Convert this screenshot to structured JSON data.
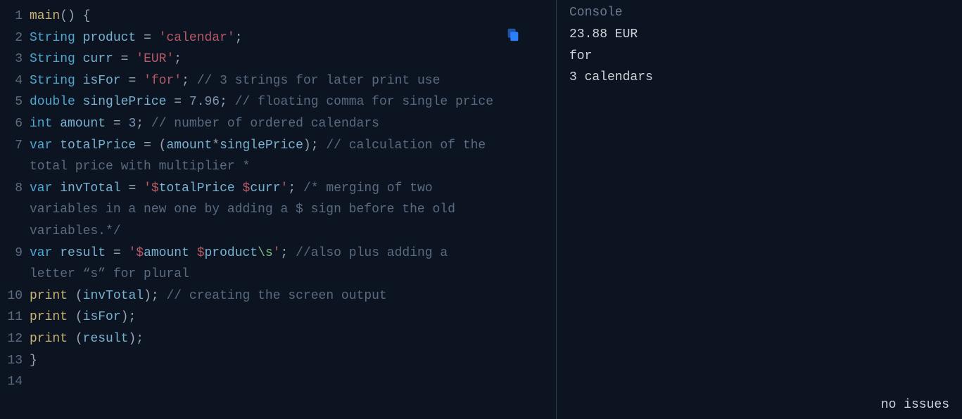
{
  "editor": {
    "lines": [
      {
        "num": "1",
        "tokens": [
          [
            "fn",
            "main"
          ],
          [
            "punc",
            "() {"
          ]
        ]
      },
      {
        "num": "2",
        "tokens": [
          [
            "kw",
            "String"
          ],
          [
            "pl",
            " "
          ],
          [
            "id",
            "product"
          ],
          [
            "pl",
            " "
          ],
          [
            "punc",
            "="
          ],
          [
            "pl",
            " "
          ],
          [
            "str",
            "'calendar'"
          ],
          [
            "punc",
            ";"
          ]
        ]
      },
      {
        "num": "3",
        "tokens": [
          [
            "kw",
            "String"
          ],
          [
            "pl",
            " "
          ],
          [
            "id",
            "curr"
          ],
          [
            "pl",
            " "
          ],
          [
            "punc",
            "="
          ],
          [
            "pl",
            " "
          ],
          [
            "str",
            "'EUR'"
          ],
          [
            "punc",
            ";"
          ]
        ]
      },
      {
        "num": "4",
        "tokens": [
          [
            "kw",
            "String"
          ],
          [
            "pl",
            " "
          ],
          [
            "id",
            "isFor"
          ],
          [
            "pl",
            " "
          ],
          [
            "punc",
            "="
          ],
          [
            "pl",
            " "
          ],
          [
            "str",
            "'for'"
          ],
          [
            "punc",
            ";"
          ],
          [
            "pl",
            " "
          ],
          [
            "cmt",
            "// 3 strings for later print use"
          ]
        ]
      },
      {
        "num": "5",
        "tokens": [
          [
            "kw",
            "double"
          ],
          [
            "pl",
            " "
          ],
          [
            "id",
            "singlePrice"
          ],
          [
            "pl",
            " "
          ],
          [
            "punc",
            "="
          ],
          [
            "pl",
            " "
          ],
          [
            "num",
            "7.96"
          ],
          [
            "punc",
            ";"
          ],
          [
            "pl",
            " "
          ],
          [
            "cmt",
            "// floating comma for single price"
          ]
        ]
      },
      {
        "num": "6",
        "tokens": [
          [
            "kw",
            "int"
          ],
          [
            "pl",
            " "
          ],
          [
            "id",
            "amount"
          ],
          [
            "pl",
            " "
          ],
          [
            "punc",
            "="
          ],
          [
            "pl",
            " "
          ],
          [
            "num",
            "3"
          ],
          [
            "punc",
            ";"
          ],
          [
            "pl",
            " "
          ],
          [
            "cmt",
            "// number of ordered calendars"
          ]
        ]
      },
      {
        "num": "7",
        "tokens": [
          [
            "kw",
            "var"
          ],
          [
            "pl",
            " "
          ],
          [
            "id",
            "totalPrice"
          ],
          [
            "pl",
            " "
          ],
          [
            "punc",
            "= ("
          ],
          [
            "id",
            "amount"
          ],
          [
            "punc",
            "*"
          ],
          [
            "id",
            "singlePrice"
          ],
          [
            "punc",
            ");"
          ],
          [
            "pl",
            " "
          ],
          [
            "cmt",
            "// calculation of the total price with multiplier *"
          ]
        ]
      },
      {
        "num": "8",
        "tokens": [
          [
            "kw",
            "var"
          ],
          [
            "pl",
            " "
          ],
          [
            "id",
            "invTotal"
          ],
          [
            "pl",
            " "
          ],
          [
            "punc",
            "="
          ],
          [
            "pl",
            " "
          ],
          [
            "str",
            "'$"
          ],
          [
            "id",
            "totalPrice"
          ],
          [
            "str",
            " $"
          ],
          [
            "id",
            "curr"
          ],
          [
            "str",
            "'"
          ],
          [
            "punc",
            ";"
          ],
          [
            "pl",
            " "
          ],
          [
            "cmt",
            "/* merging of two variables in a new one by adding a $ sign before the old variables.*/"
          ]
        ]
      },
      {
        "num": "9",
        "tokens": [
          [
            "kw",
            "var"
          ],
          [
            "pl",
            " "
          ],
          [
            "id",
            "result"
          ],
          [
            "pl",
            " "
          ],
          [
            "punc",
            "="
          ],
          [
            "pl",
            " "
          ],
          [
            "str",
            "'$"
          ],
          [
            "id",
            "amount"
          ],
          [
            "str",
            " $"
          ],
          [
            "id",
            "product"
          ],
          [
            "esc",
            "\\s"
          ],
          [
            "str",
            "'"
          ],
          [
            "punc",
            ";"
          ],
          [
            "pl",
            " "
          ],
          [
            "cmt",
            "//also plus adding a letter “s” for plural"
          ]
        ]
      },
      {
        "num": "10",
        "tokens": [
          [
            "fn",
            "print"
          ],
          [
            "pl",
            " "
          ],
          [
            "punc",
            "("
          ],
          [
            "id",
            "invTotal"
          ],
          [
            "punc",
            ");"
          ],
          [
            "pl",
            " "
          ],
          [
            "cmt",
            "// creating the screen output"
          ]
        ]
      },
      {
        "num": "11",
        "tokens": [
          [
            "fn",
            "print"
          ],
          [
            "pl",
            " "
          ],
          [
            "punc",
            "("
          ],
          [
            "id",
            "isFor"
          ],
          [
            "punc",
            ");"
          ]
        ]
      },
      {
        "num": "12",
        "tokens": [
          [
            "fn",
            "print"
          ],
          [
            "pl",
            " "
          ],
          [
            "punc",
            "("
          ],
          [
            "id",
            "result"
          ],
          [
            "punc",
            ");"
          ]
        ]
      },
      {
        "num": "13",
        "tokens": [
          [
            "punc",
            "}"
          ]
        ]
      },
      {
        "num": "14",
        "tokens": []
      }
    ]
  },
  "console": {
    "title": "Console",
    "output": "23.88 EUR\nfor\n3 calendars",
    "status": "no issues"
  }
}
